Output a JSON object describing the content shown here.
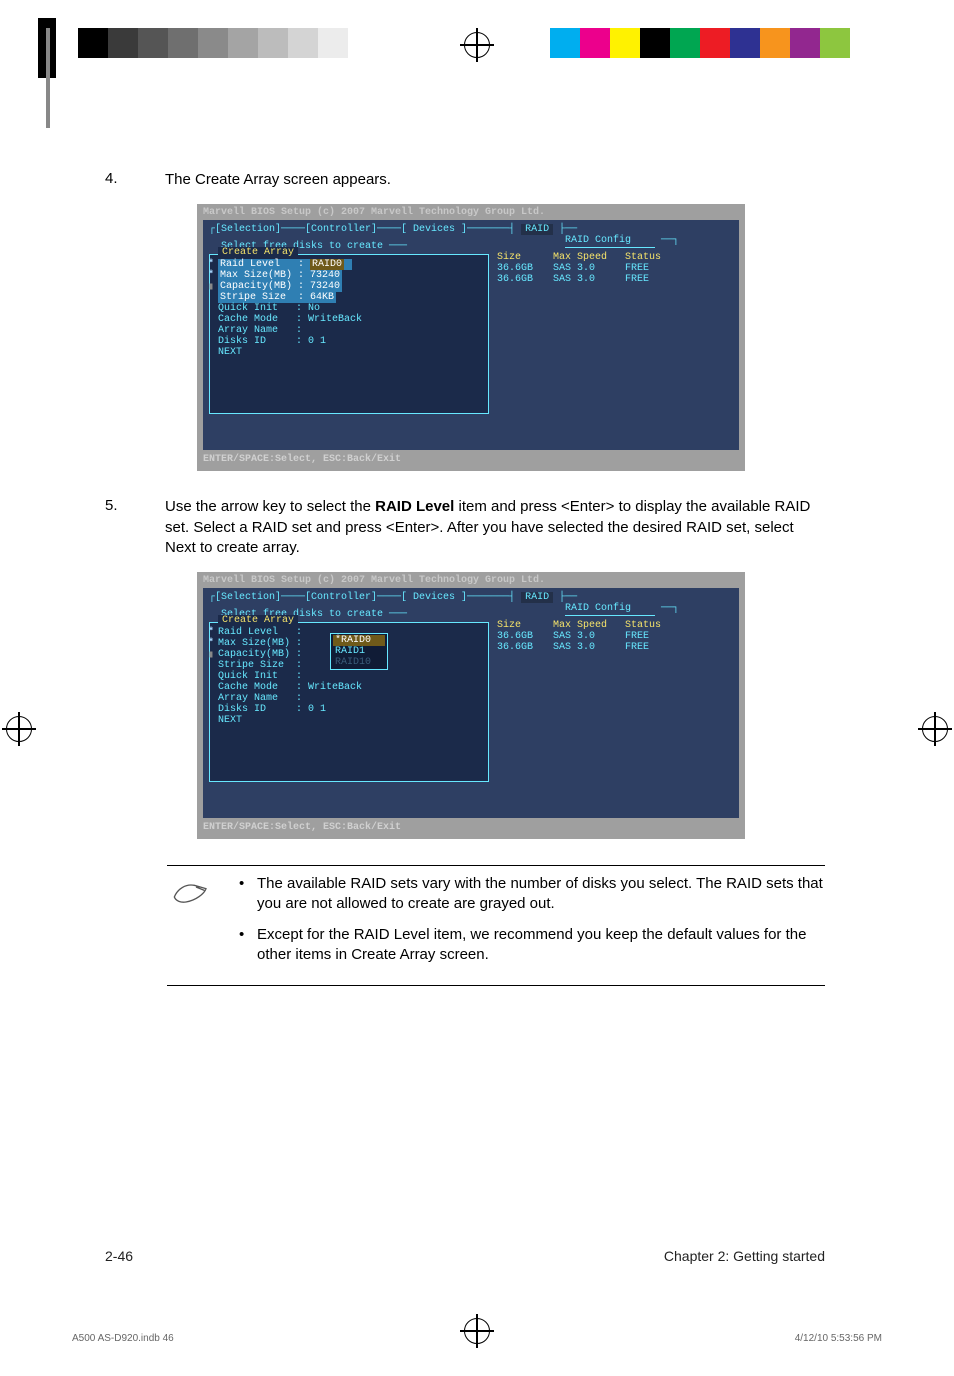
{
  "registration": {
    "greys": [
      "#000",
      "#3a3a3a",
      "#555",
      "#6f6f6f",
      "#8a8a8a",
      "#a4a4a4",
      "#bcbcbc",
      "#d4d4d4",
      "#ececec"
    ],
    "colors": [
      "#00aeef",
      "#ec008c",
      "#fff200",
      "#000000",
      "#00a651",
      "#ed1c24",
      "#2e3192",
      "#f7941d",
      "#92278f",
      "#8dc63f"
    ]
  },
  "step4": {
    "num": "4.",
    "text": "The Create Array screen appears."
  },
  "step5": {
    "num": "5.",
    "text_a": "Use the arrow key to select the ",
    "bold": "RAID Level",
    "text_b": " item and press <Enter> to display the available RAID set. Select a RAID set and press <Enter>. After you have selected the desired RAID set, select Next to create array."
  },
  "bios": {
    "title": "Marvell BIOS Setup (c) 2007 Marvell Technology Group Ltd.",
    "tabs": "┌[Selection]────[Controller]────[ Devices ]───────┤",
    "raid_tab": "RAID",
    "raid_config": "RAID Config",
    "select_free": "Select free disks to create ───",
    "create_array": "Create Array",
    "fields1": {
      "raid_level": "Raid Level   :",
      "raid_level_v": "RAID0",
      "max_size": "Max Size(MB) : 73240",
      "capacity": "Capacity(MB) : 73240",
      "stripe": "Stripe Size  : 64KB",
      "quick": "Quick Init   : No",
      "cache": "Cache Mode   : WriteBack",
      "arrname": "Array Name   :",
      "disks": "Disks ID     : 0 1",
      "next": "NEXT"
    },
    "fields2": {
      "raid_level": "Raid Level   :",
      "max_size": "Max Size(MB) :",
      "capacity": "Capacity(MB) :",
      "stripe": "Stripe Size  :",
      "quick": "Quick Init   :",
      "cache": "Cache Mode   : WriteBack",
      "arrname": "Array Name   :",
      "disks": "Disks ID     : 0 1",
      "next": "NEXT"
    },
    "dropdown": {
      "opt1": "*RAID0",
      "opt2": "RAID1",
      "opt3": "RAID10"
    },
    "table": {
      "h1": "Size",
      "h2": "Max Speed",
      "h3": "Status",
      "r1c1": "36.6GB",
      "r1c2": "SAS 3.0",
      "r1c3": "FREE",
      "r2c1": "36.6GB",
      "r2c2": "SAS 3.0",
      "r2c3": "FREE"
    },
    "foot": "ENTER/SPACE:Select, ESC:Back/Exit"
  },
  "notes": {
    "n1": "The available RAID sets vary with the number of disks you select. The RAID sets that you are not allowed to create are grayed out.",
    "n2": "Except for the RAID Level item, we recommend you keep the default values for the other items in Create Array screen."
  },
  "footer": {
    "left": "2-46",
    "right": "Chapter 2: Getting started"
  },
  "printfoot": {
    "left": "A500 AS-D920.indb   46",
    "right": "4/12/10   5:53:56 PM"
  },
  "chart_data": {
    "type": "table",
    "context": "Disk list shown in Marvell BIOS RAID Create Array screen",
    "columns": [
      "Size",
      "Max Speed",
      "Status"
    ],
    "rows": [
      [
        "36.6GB",
        "SAS 3.0",
        "FREE"
      ],
      [
        "36.6GB",
        "SAS 3.0",
        "FREE"
      ]
    ],
    "create_array_defaults": {
      "Raid Level": "RAID0",
      "Max Size(MB)": 73240,
      "Capacity(MB)": 73240,
      "Stripe Size": "64KB",
      "Quick Init": "No",
      "Cache Mode": "WriteBack",
      "Disks ID": "0 1"
    },
    "raid_level_options": [
      "RAID0",
      "RAID1",
      "RAID10"
    ]
  }
}
